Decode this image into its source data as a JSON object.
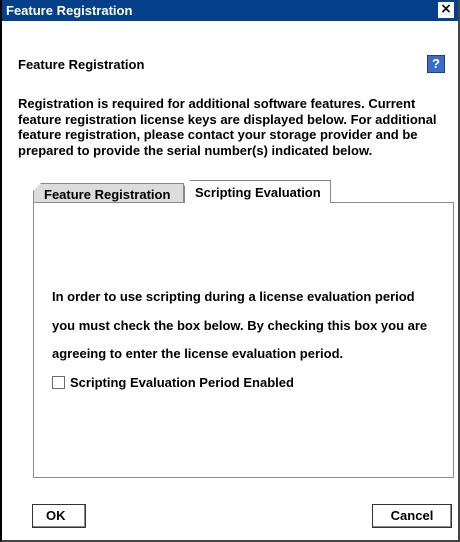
{
  "window": {
    "title": "Feature Registration",
    "close_symbol": "×"
  },
  "header": {
    "title": "Feature Registration",
    "help_symbol": "?"
  },
  "description": "Registration is required for additional software features. Current feature registration license keys are displayed below. For additional feature registration, please contact your storage provider and be prepared to provide the serial number(s) indicated below.",
  "tabs": [
    {
      "label": "Feature Registration",
      "selected": false
    },
    {
      "label": "Scripting Evaluation",
      "selected": true
    }
  ],
  "scripting_panel": {
    "lines": [
      "In order to use scripting during a license evaluation period",
      "you must check the box below. By checking this box you are",
      "agreeing to enter the license evaluation period."
    ],
    "checkbox_label": "Scripting Evaluation Period Enabled",
    "checkbox_checked": false
  },
  "buttons": {
    "ok": "OK",
    "cancel": "Cancel"
  },
  "colors": {
    "titlebar": "#06408a",
    "help_button": "#3a6cc8"
  },
  "icons": {
    "close": "close-icon",
    "help": "help-icon"
  }
}
